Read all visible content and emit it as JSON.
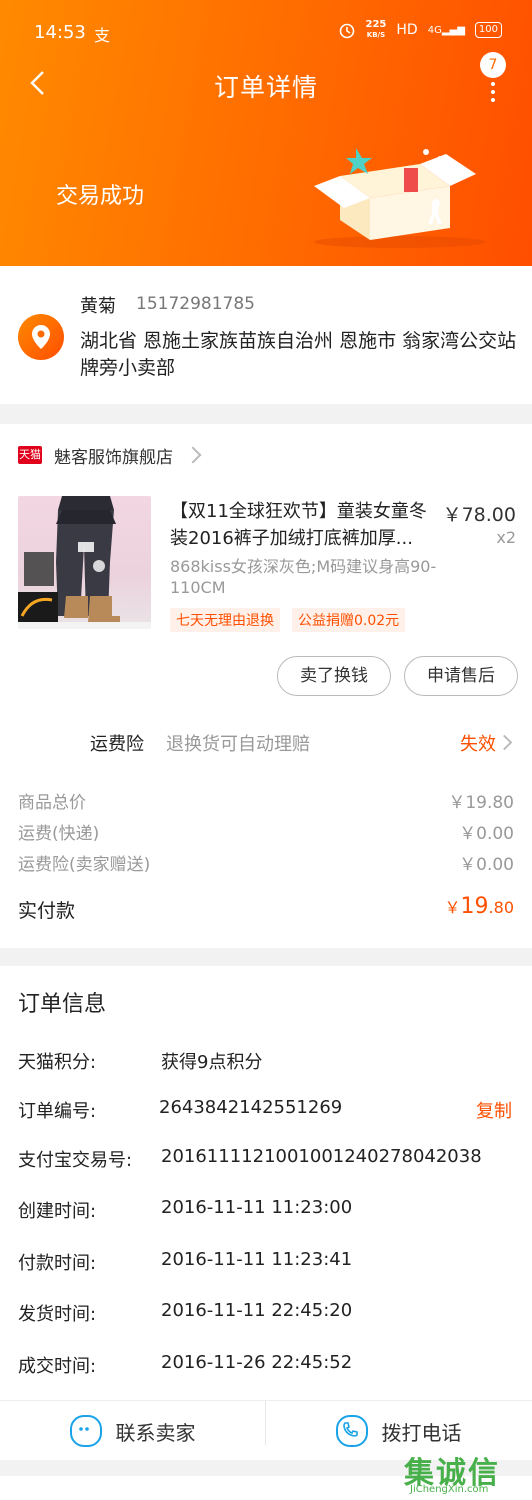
{
  "status_bar": {
    "time": "14:53",
    "app_icon": "支",
    "net_speed": "225",
    "net_unit": "KB/S",
    "hd": "HD",
    "network": "4G",
    "battery": "100"
  },
  "nav": {
    "title": "订单详情",
    "badge_count": "7"
  },
  "banner": {
    "status_text": "交易成功"
  },
  "address": {
    "name": "黄菊",
    "phone": "15172981785",
    "full_address": "湖北省 恩施土家族苗族自治州 恩施市 翁家湾公交站牌旁小卖部"
  },
  "shop": {
    "logo_text": "天猫",
    "name": "魅客服饰旗舰店"
  },
  "product": {
    "title": "【双11全球狂欢节】童装女童冬装2016裤子加绒打底裤加厚...",
    "price": "￥78.00",
    "quantity": "x2",
    "sku": "868kiss女孩深灰色;M码建议身高90-110CM",
    "tags": [
      "七天无理由退换",
      "公益捐赠0.02元"
    ]
  },
  "actions": {
    "sell_label": "卖了换钱",
    "after_sale_label": "申请售后"
  },
  "insurance": {
    "label": "运费险",
    "desc": "退换货可自动理赔",
    "status": "失效"
  },
  "prices": [
    {
      "label": "商品总价",
      "value": "￥19.80"
    },
    {
      "label": "运费(快递)",
      "value": "￥0.00"
    },
    {
      "label": "运费险(卖家赠送)",
      "value": "￥0.00"
    }
  ],
  "paid": {
    "label": "实付款",
    "currency": "￥",
    "int": "19",
    "dec": ".80"
  },
  "order_info": {
    "title": "订单信息",
    "rows": [
      {
        "label": "天猫积分:",
        "value": "获得9点积分"
      },
      {
        "label": "订单编号:",
        "value": "2643842142551269"
      },
      {
        "label": "支付宝交易号:",
        "value": "2016111121001001240278042038"
      },
      {
        "label": "创建时间:",
        "value": "2016-11-11 11:23:00"
      },
      {
        "label": "付款时间:",
        "value": "2016-11-11 11:23:41"
      },
      {
        "label": "发货时间:",
        "value": "2016-11-11 22:45:20"
      },
      {
        "label": "成交时间:",
        "value": "2016-11-26 22:45:52"
      }
    ],
    "copy_label": "复制"
  },
  "contact": {
    "seller_label": "联系卖家",
    "call_label": "拨打电话"
  },
  "watermark": {
    "title": "集诚信",
    "sub": "JiChengXin.com"
  },
  "colors": {
    "accent": "#ff5000",
    "header_start": "#ff8a00",
    "header_end": "#ff4e00",
    "icon_blue": "#1aa3e8"
  }
}
